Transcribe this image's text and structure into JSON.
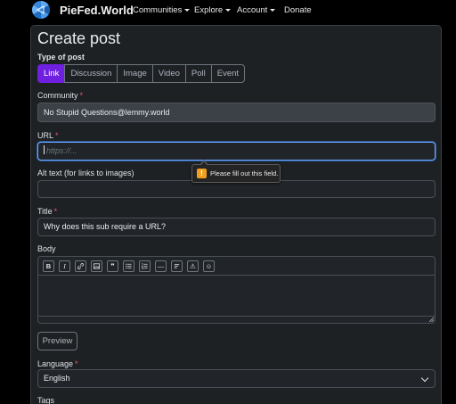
{
  "nav": {
    "brand": "PieFed.World",
    "items": [
      {
        "label": "Communities",
        "dropdown": true
      },
      {
        "label": "Explore",
        "dropdown": true
      },
      {
        "label": "Account",
        "dropdown": true
      },
      {
        "label": "Donate",
        "dropdown": false
      }
    ]
  },
  "page": {
    "title": "Create post",
    "type_label": "Type of post",
    "post_types": [
      "Link",
      "Discussion",
      "Image",
      "Video",
      "Poll",
      "Event"
    ],
    "active_type": "Link"
  },
  "form": {
    "community_label": "Community",
    "community_value": "No Stupid Questions@lemmy.world",
    "url_label": "URL",
    "url_placeholder": "https://...",
    "url_value": "",
    "alt_label": "Alt text (for links to images)",
    "alt_value": "",
    "title_label": "Title",
    "title_value": "Why does this sub require a URL?",
    "body_label": "Body",
    "preview_label": "Preview",
    "language_label": "Language",
    "language_value": "English",
    "tags_label": "Tags",
    "required_mark": "*"
  },
  "tooltip": {
    "text": "Please fill out this field.",
    "icon": "!"
  },
  "editor_toolbar": [
    {
      "name": "bold",
      "glyph": "B"
    },
    {
      "name": "italic",
      "glyph": "I"
    },
    {
      "name": "link",
      "glyph": ""
    },
    {
      "name": "image",
      "glyph": ""
    },
    {
      "name": "quote",
      "glyph": "❞"
    },
    {
      "name": "bulleted-list",
      "glyph": ""
    },
    {
      "name": "numbered-list",
      "glyph": ""
    },
    {
      "name": "horizontal-rule",
      "glyph": "—"
    },
    {
      "name": "heading",
      "glyph": ""
    },
    {
      "name": "spoiler",
      "glyph": "⚠"
    },
    {
      "name": "emoji",
      "glyph": "☺"
    }
  ],
  "colors": {
    "accent": "#6f1fe0",
    "required": "#e35d6a",
    "focus": "#6ea8fe",
    "warning": "#f0a020"
  }
}
